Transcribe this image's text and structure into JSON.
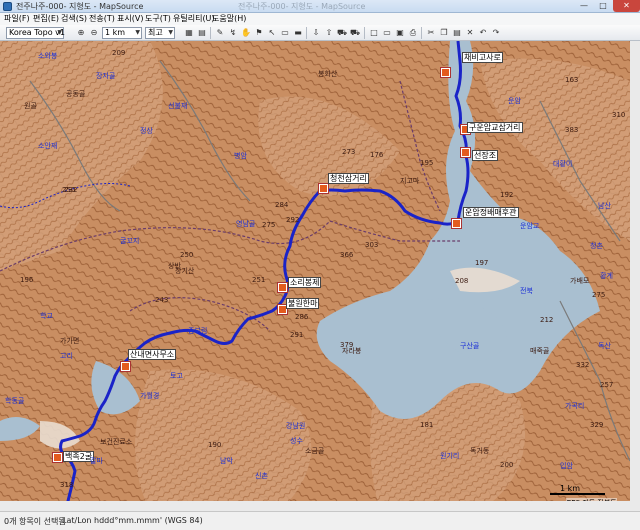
{
  "window": {
    "title": "전주나주-000- 지형도 - MapSource",
    "faded_title": "전주나주-000- 지형도 - MapSource",
    "minimize": "—",
    "maximize": "□",
    "close": "✕"
  },
  "menu": [
    "파일(F)",
    "편집(E)",
    "검색(S)",
    "전송(T)",
    "표시(V)",
    "도구(T)",
    "유틸리티(U)",
    "도움말(H)"
  ],
  "toolbar": {
    "map_product": "Korea Topo v1",
    "zoom_scale": "1 km",
    "detail_level": "최고",
    "icons": [
      "zoom-in-icon",
      "zoom-out-icon",
      "map-icon",
      "map-plus-icon",
      "pencil-icon",
      "route-icon",
      "hand-icon",
      "waypoint-icon",
      "pointer-icon",
      "selection-icon",
      "ruler-icon",
      "gps-receive-icon",
      "gps-send-icon",
      "car-icon",
      "new-file-icon",
      "open-file-icon",
      "save-icon",
      "print-icon",
      "cut-icon",
      "copy-icon",
      "paste-icon",
      "delete-icon",
      "undo-icon",
      "redo-icon"
    ]
  },
  "map": {
    "waypoints": [
      {
        "id": "w1",
        "label": "채비고사로"
      },
      {
        "id": "w2",
        "label": "구운암교삼거리"
      },
      {
        "id": "w3",
        "label": "선장조"
      },
      {
        "id": "w4",
        "label": "청천삼거리"
      },
      {
        "id": "w5",
        "label": "운암정배매후관"
      },
      {
        "id": "w6",
        "label": "소리봉제"
      },
      {
        "id": "w7",
        "label": "불원한마"
      },
      {
        "id": "w8",
        "label": "산내면사무소"
      },
      {
        "id": "w9",
        "label": "백족2굴"
      }
    ],
    "terrain_labels": {
      "blue": [
        "소와봉",
        "장자골",
        "운암",
        "선불재",
        "소안재",
        "병암",
        "영남골",
        "굴꼬지",
        "대황이",
        "운암교",
        "남산",
        "청촌",
        "학교",
        "중부림",
        "고리",
        "토고",
        "가월경",
        "강남원",
        "성수",
        "구산골",
        "가곡리",
        "독산",
        "전북",
        "입암",
        "학동골",
        "갈마",
        "남악",
        "신촌",
        "원기리",
        "황계",
        "정상"
      ],
      "numbers": [
        "209",
        "250",
        "284",
        "292",
        "273",
        "176",
        "195",
        "192",
        "303",
        "366",
        "286",
        "291",
        "197",
        "208",
        "212",
        "332",
        "257",
        "275",
        "163",
        "310",
        "383",
        "329",
        "379",
        "232",
        "250",
        "251",
        "196",
        "200",
        "181",
        "242",
        "308",
        "216",
        "293",
        "219",
        "350",
        "403",
        "318",
        "190",
        "307",
        "195",
        "275",
        "243",
        "341"
      ],
      "dark": [
        "공동골",
        "원골",
        "봉화산",
        "상반",
        "가가면",
        "장기산",
        "보건진료소",
        "매죽골",
        "독거동",
        "자라봉",
        "소금골",
        "가배모",
        "지고마"
      ]
    },
    "scale": "1 km",
    "copyright": "GPS 지도 정복도"
  },
  "status": {
    "selection": "0개 항목이 선택됨",
    "coord_format": "Lat/Lon hddd°mm.mmm' (WGS 84)"
  }
}
